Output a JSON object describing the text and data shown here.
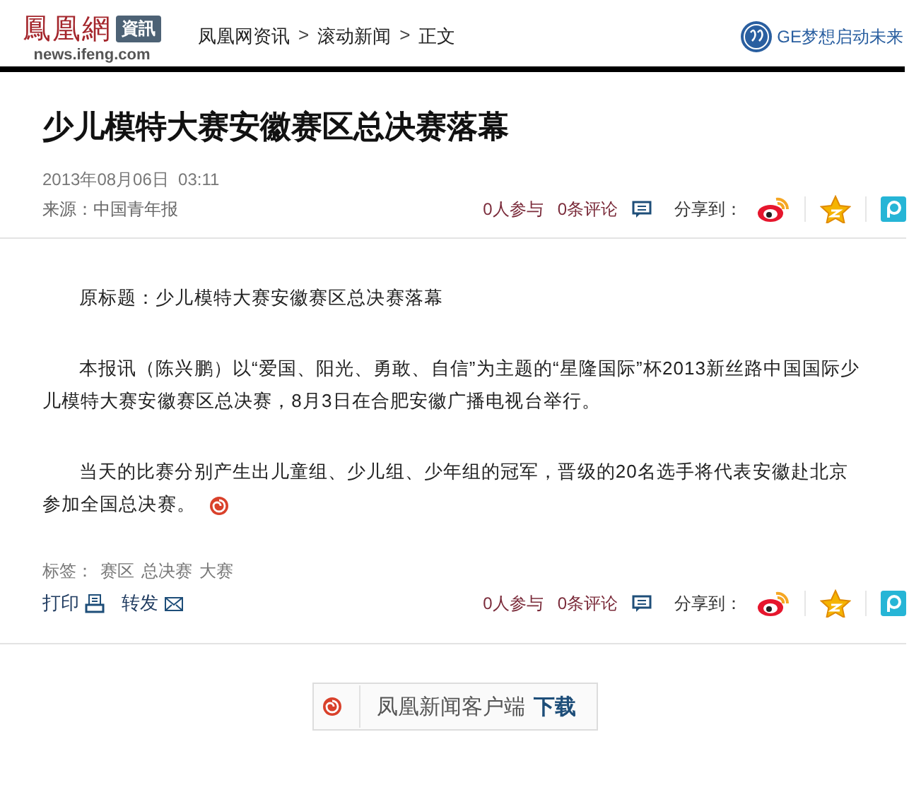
{
  "header": {
    "logo": "鳳凰網",
    "logo_badge": "資訊",
    "logo_domain": "news.ifeng.com",
    "breadcrumb": [
      {
        "label": "凤凰网资讯"
      },
      {
        "label": "滚动新闻"
      },
      {
        "label": "正文"
      }
    ],
    "breadcrumb_separator": ">",
    "sponsor": "GE梦想启动未来"
  },
  "article": {
    "title": "少儿模特大赛安徽赛区总决赛落幕",
    "date": "2013年08月06日  03:11",
    "source": "来源：中国青年报",
    "paragraphs": [
      {
        "text": "原标题：少儿模特大赛安徽赛区总决赛落幕",
        "trailing_icon": false
      },
      {
        "text": "本报讯（陈兴鹏）以“爱国、阳光、勇敢、自信”为主题的“星隆国际”杯2013新丝路中国国际少儿模特大赛安徽赛区总决赛，8月3日在合肥安徽广播电视台举行。",
        "trailing_icon": false
      },
      {
        "text": "当天的比赛分别产生出儿童组、少儿组、少年组的冠军，晋级的20名选手将代表安徽赴北京参加全国总决赛。",
        "trailing_icon": true
      }
    ],
    "tags_label": "标签：",
    "tags": [
      "赛区",
      "总决赛",
      "大赛"
    ],
    "actions": [
      {
        "kind": "print",
        "label": "打印"
      },
      {
        "kind": "forward",
        "label": "转发"
      }
    ]
  },
  "share_bars": [
    {
      "participants": "0人参与",
      "comments": "0条评论",
      "share_label": "分享到："
    },
    {
      "participants": "0人参与",
      "comments": "0条评论",
      "share_label": "分享到："
    }
  ],
  "app_banner": {
    "text": "凤凰新闻客户端",
    "action": "下载"
  }
}
